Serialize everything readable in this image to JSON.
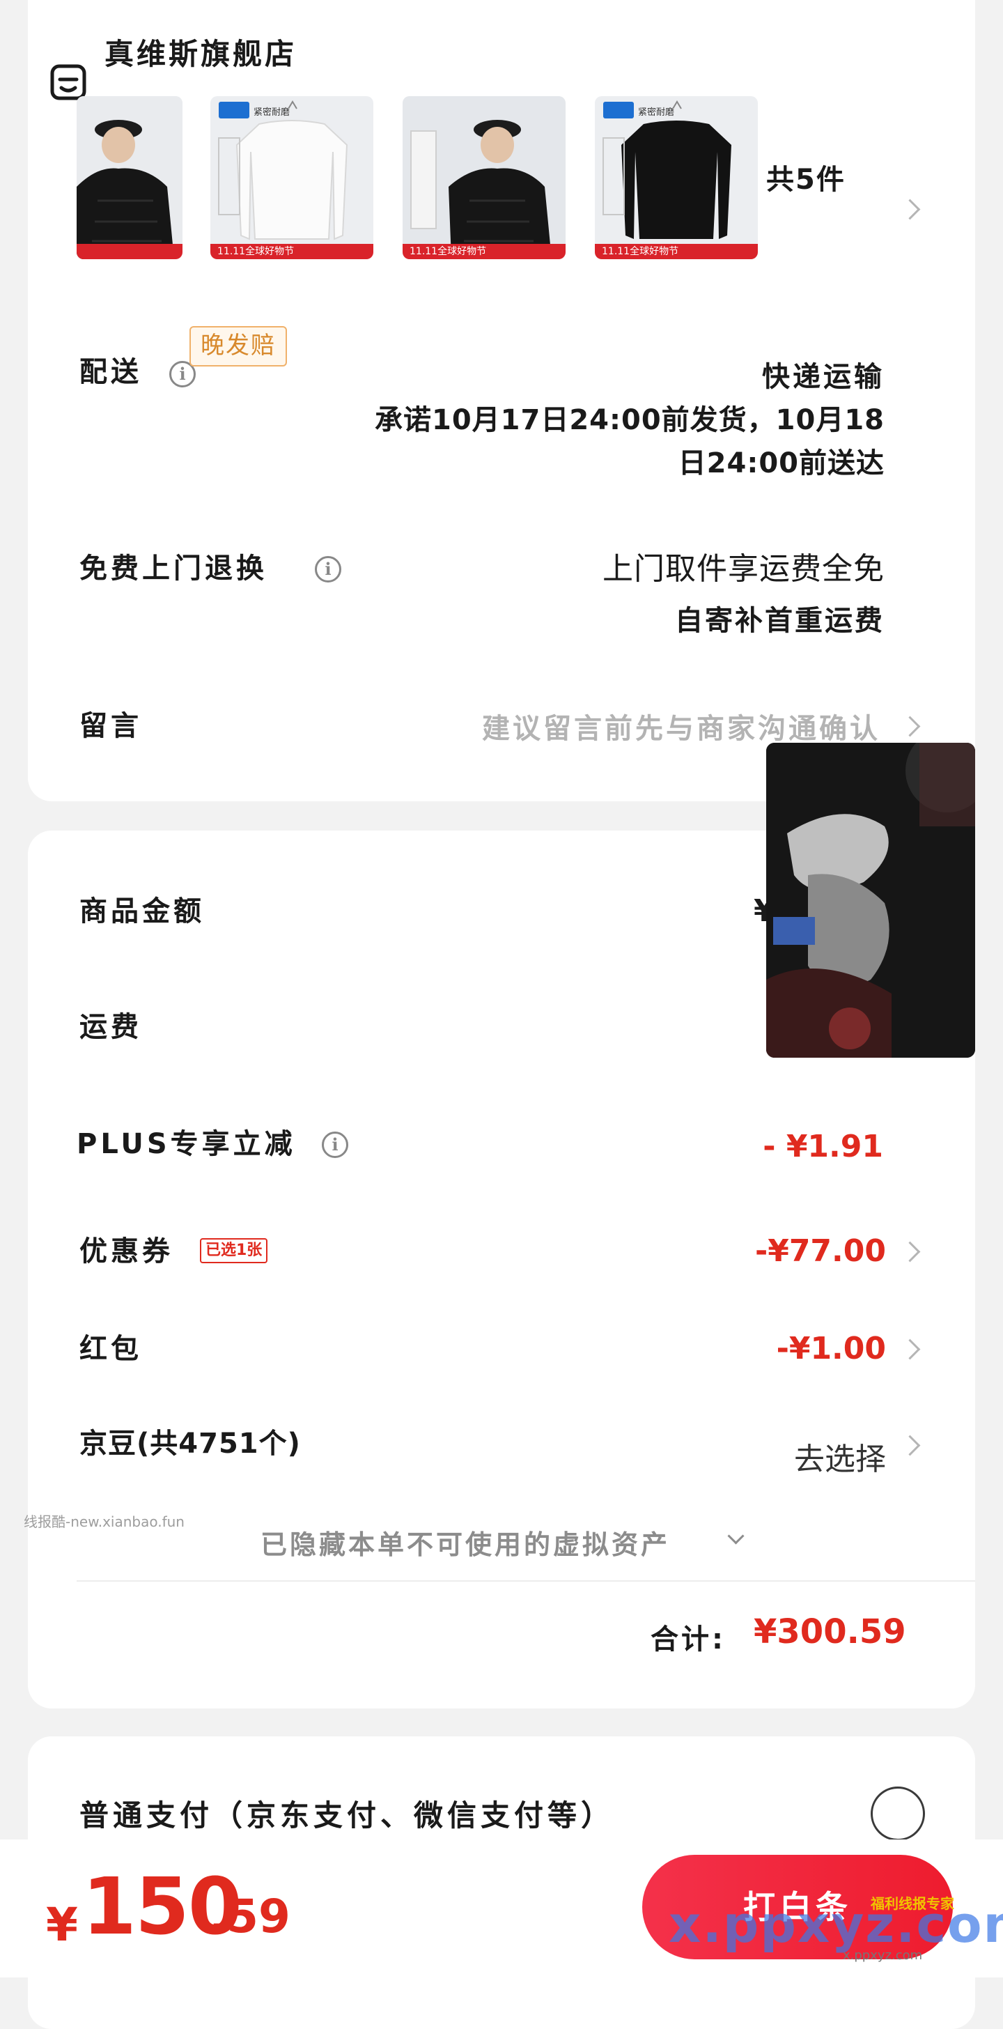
{
  "store": {
    "name": "真维斯旗舰店",
    "item_count_label": "共5件",
    "thumbnails": [
      {
        "kind": "black-puffer-jacket",
        "band_text": ""
      },
      {
        "kind": "white-long-sleeve-tee",
        "band_text": "11.11全球好物节",
        "tag": "紧密耐磨"
      },
      {
        "kind": "black-puffer-jacket",
        "band_text": "11.11全球好物节"
      },
      {
        "kind": "black-long-sleeve-tee",
        "band_text": "11.11全球好物节",
        "tag": "紧密耐磨"
      }
    ]
  },
  "delivery": {
    "label": "配送",
    "badge": "晚发赔",
    "mode": "快递运输",
    "promise_line1": "承诺10月17日24:00前发货，10月18",
    "promise_line2": "日24:00前送达"
  },
  "returns": {
    "label": "免费上门退换",
    "line1": "上门取件享运费全免",
    "line2": "自寄补首重运费"
  },
  "message": {
    "label": "留言",
    "placeholder": "建议留言前先与商家沟通确认"
  },
  "price": {
    "goods_label": "商品金额",
    "goods_value_partial": "¥",
    "shipping_label": "运费",
    "plus_label": "PLUS专享立减",
    "plus_value": "- ¥1.91",
    "coupon_label": "优惠券",
    "coupon_tag": "已选1张",
    "coupon_value": "-¥77.00",
    "redpacket_label": "红包",
    "redpacket_value": "-¥1.00",
    "jingdou_label": "京豆(共4751个)",
    "jingdou_action": "去选择",
    "hidden_assets": "已隐藏本单不可使用的虚拟资产",
    "total_label": "合计:",
    "total_value": "¥300.59"
  },
  "payment": {
    "label": "普通支付（京东支付、微信支付等）"
  },
  "bottom": {
    "currency": "¥",
    "amount_int": "150",
    "amount_dec": ".59",
    "submit_label": "打白条"
  },
  "watermarks": {
    "left": "线报酷-new.xianbao.fun",
    "badge": "福利线报专家",
    "url": "x.ppxyz.com",
    "url_small": "x.ppxyz.com"
  },
  "colors": {
    "accent_red": "#e02a1e",
    "badge_orange": "#d8892c",
    "placeholder_gray": "#b3b3b3"
  }
}
